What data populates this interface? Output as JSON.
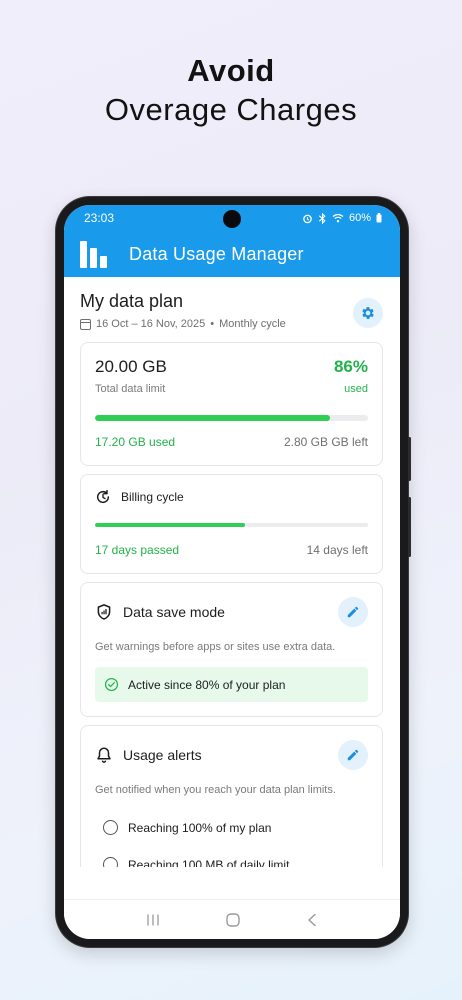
{
  "headline": {
    "line1": "Avoid",
    "line2": "Overage Charges"
  },
  "status_bar": {
    "time": "23:03",
    "battery": "60%"
  },
  "app_bar": {
    "title": "Data Usage Manager"
  },
  "plan": {
    "title": "My data plan",
    "date_range": "16 Oct – 16 Nov, 2025",
    "cycle_type": "Monthly cycle"
  },
  "data_limit": {
    "total": "20.00 GB",
    "total_label": "Total data limit",
    "percent": "86%",
    "percent_label": "used",
    "used": "17.20 GB used",
    "left": "2.80 GB GB left",
    "progress": 0.86
  },
  "billing": {
    "title": "Billing cycle",
    "passed": "17 days passed",
    "left": "14 days left",
    "progress": 0.5484
  },
  "data_save": {
    "title": "Data save mode",
    "description": "Get warnings before apps or sites use extra data.",
    "active_text": "Active since 80% of your plan"
  },
  "alerts": {
    "title": "Usage alerts",
    "description": "Get notified when you reach your data plan limits.",
    "options": [
      "Reaching 100% of my plan",
      "Reaching 100 MB of daily limit"
    ]
  },
  "icons": {
    "logo": "bar-chart-icon",
    "settings": "gear-icon",
    "calendar": "calendar-icon",
    "billing": "refresh-clock-icon",
    "data_save": "shield-icon",
    "alerts": "bell-icon",
    "edit": "pencil-icon",
    "check": "check-circle-icon"
  },
  "colors": {
    "brand": "#1a9aea",
    "success": "#22b24c",
    "progress": "#2fcf56",
    "accent_bg": "#e3f1fc",
    "active_bg": "#e6f9ea"
  }
}
